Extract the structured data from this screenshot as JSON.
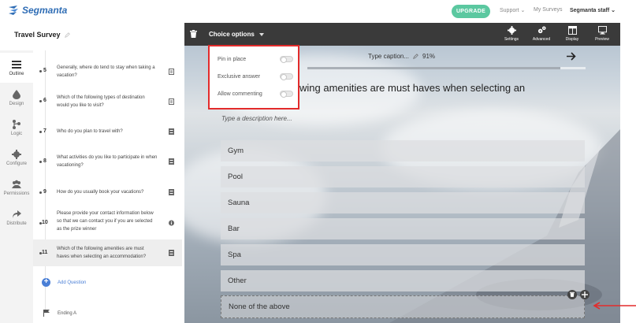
{
  "app": {
    "brand": "Segmanta"
  },
  "topnav": {
    "upgrade": "UPGRADE",
    "support": "Support ⌄",
    "my_surveys": "My Surveys",
    "user": "Segmanta staff ⌄"
  },
  "survey": {
    "title": "Travel Survey"
  },
  "leftnav": [
    {
      "label": "Outline",
      "icon": "list-icon"
    },
    {
      "label": "Design",
      "icon": "drop-icon"
    },
    {
      "label": "Logic",
      "icon": "logic-icon"
    },
    {
      "label": "Configure",
      "icon": "gear-icon"
    },
    {
      "label": "Permissions",
      "icon": "people-icon"
    },
    {
      "label": "Distribute",
      "icon": "share-icon"
    }
  ],
  "questions": [
    {
      "num": "5",
      "text": "Generally, where do tend to stay when taking a vacation?",
      "icon": "text-icon"
    },
    {
      "num": "6",
      "text": "Which of the following types of destination would you like to visit?",
      "icon": "text-icon"
    },
    {
      "num": "7",
      "text": "Who do you plan to travel with?",
      "icon": "choice-icon"
    },
    {
      "num": "8",
      "text": "What activities do you like to participate in when vacationing?",
      "icon": "choice-icon"
    },
    {
      "num": "9",
      "text": "How do you usually book your vacations?",
      "icon": "choice-icon"
    },
    {
      "num": "10",
      "text": "Please provide your contact information below so that we can contact you if you are selected as the prize winner",
      "icon": "info-icon"
    },
    {
      "num": "11",
      "text": "Which of the following amenities are must haves when selecting an accommodation?",
      "icon": "choice-icon"
    }
  ],
  "add_question": "Add Question",
  "ending": "Ending A",
  "toolbar": {
    "choice_options": "Choice options",
    "tools": [
      {
        "label": "Settings"
      },
      {
        "label": "Advanced"
      },
      {
        "label": "Display"
      },
      {
        "label": "Preview"
      }
    ]
  },
  "popover": {
    "options": [
      {
        "label": "Pin in place",
        "on": false
      },
      {
        "label": "Exclusive answer",
        "on": false
      },
      {
        "label": "Allow commenting",
        "on": false
      }
    ]
  },
  "editor": {
    "caption": "Type caption...",
    "progress": "91%",
    "progress_value": 0.91,
    "question_title": "wing amenities are must haves when selecting an",
    "description": "Type a description here...",
    "choices": [
      "Gym",
      "Pool",
      "Sauna",
      "Bar",
      "Spa",
      "Other",
      "None of the above"
    ]
  },
  "colors": {
    "accent": "#5bc8a0",
    "brand": "#2f6db5",
    "highlight": "#e32b2b",
    "toolbar": "#3a3a3a"
  }
}
